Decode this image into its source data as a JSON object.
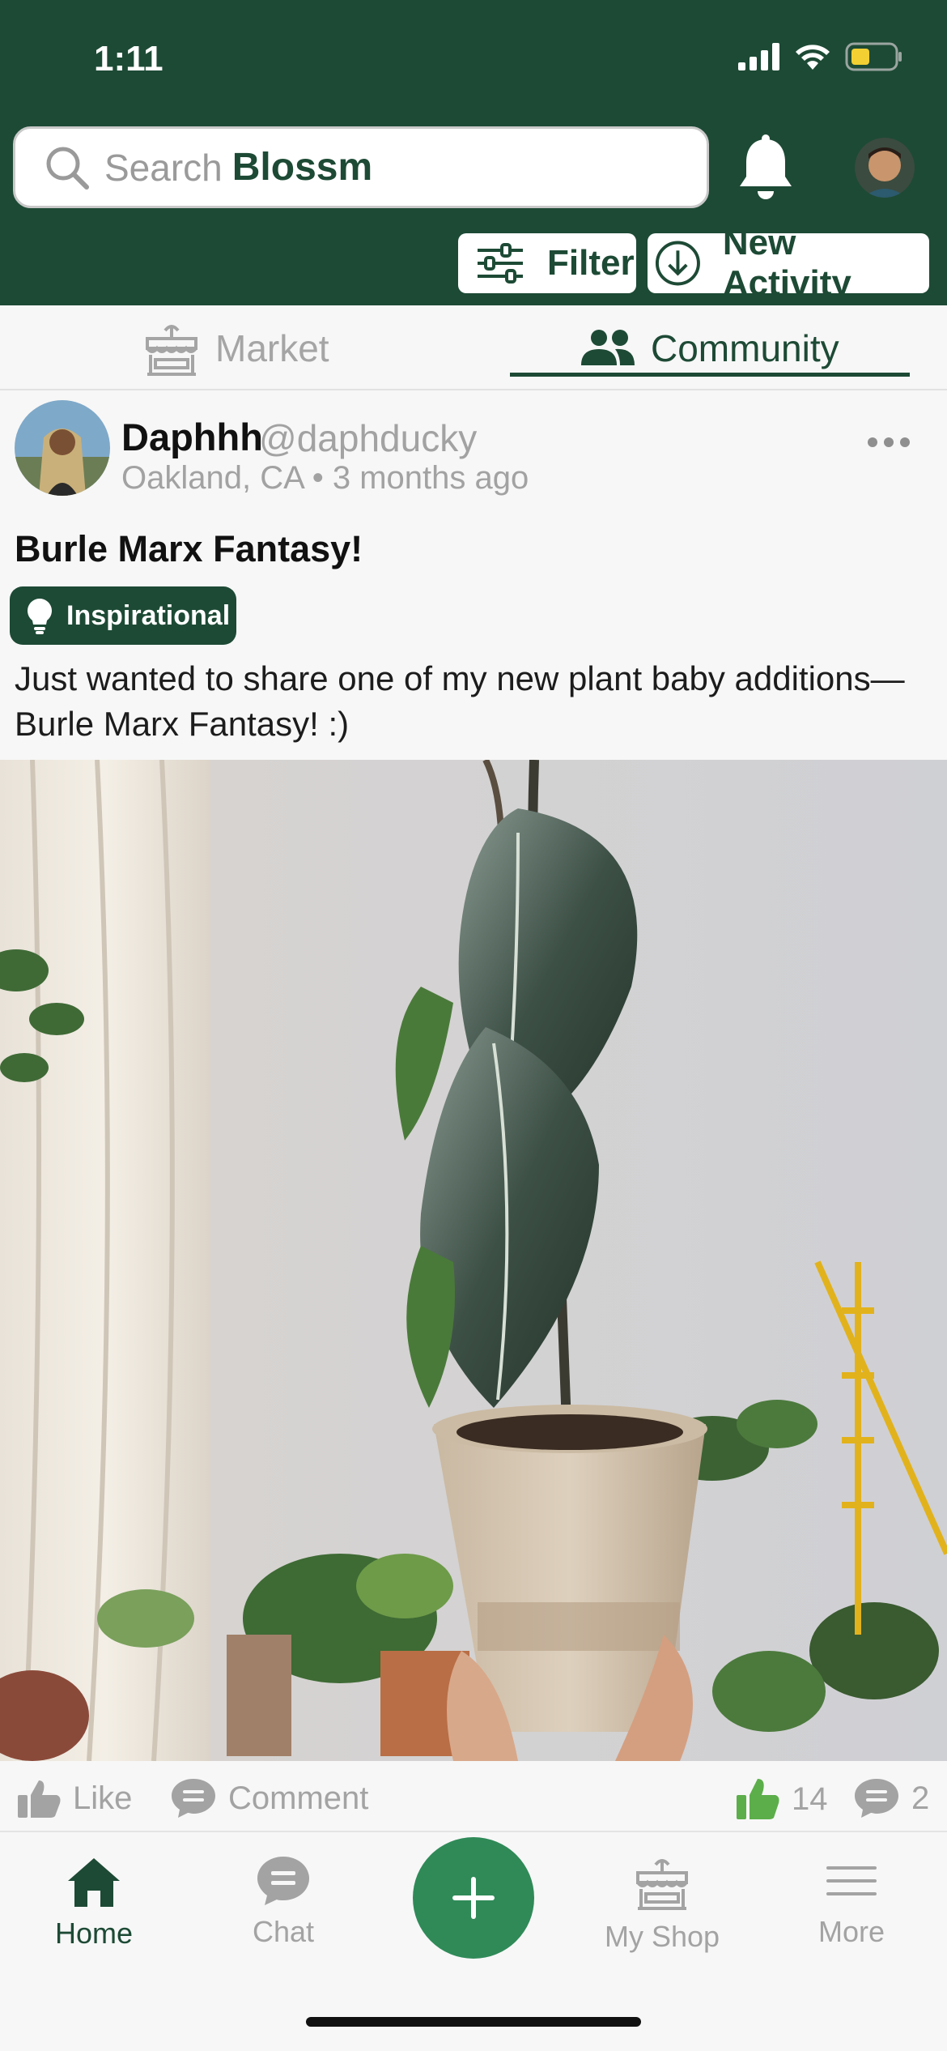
{
  "status_bar": {
    "time": "1:11"
  },
  "header": {
    "search_prefix": "Search",
    "search_brand": "Blossm",
    "filter_label": "Filter",
    "new_activity_label": "New Activity"
  },
  "tabs": [
    {
      "label": "Market",
      "active": false
    },
    {
      "label": "Community",
      "active": true
    }
  ],
  "post": {
    "author_name": "Daphhh",
    "author_handle": "@daphducky",
    "location": "Oakland, CA",
    "time_ago": "3 months ago",
    "meta_separator": "•",
    "title": "Burle Marx Fantasy!",
    "tag": "Inspirational",
    "body": "Just wanted to share one of my new plant baby additions—Burle Marx Fantasy! :)"
  },
  "actions": {
    "like_label": "Like",
    "comment_label": "Comment",
    "like_count": "14",
    "comment_count": "2"
  },
  "bottom_nav": {
    "home": "Home",
    "chat": "Chat",
    "my_shop": "My Shop",
    "more": "More"
  },
  "colors": {
    "brand_dark_green": "#1d4a35",
    "accent_green": "#2f8a58",
    "like_green": "#5cae4a",
    "muted_gray": "#a3a3a3"
  }
}
